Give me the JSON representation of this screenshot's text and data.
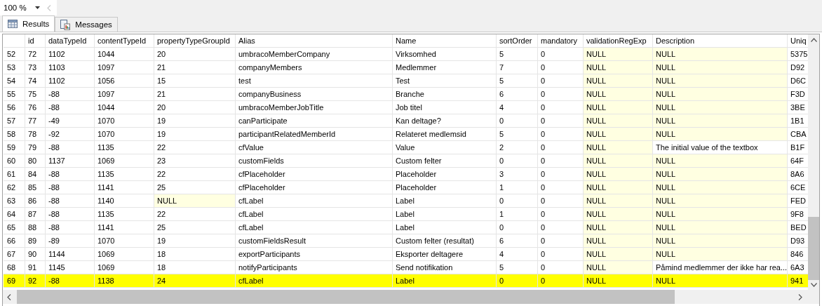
{
  "zoom": "100 %",
  "tabs": [
    {
      "label": "Results",
      "selected": true,
      "kind": "grid"
    },
    {
      "label": "Messages",
      "selected": false,
      "kind": "messages"
    }
  ],
  "columns": [
    "id",
    "dataTypeId",
    "contentTypeId",
    "propertyTypeGroupId",
    "Alias",
    "Name",
    "sortOrder",
    "mandatory",
    "validationRegExp",
    "Description",
    "Uniq"
  ],
  "rows": [
    {
      "row_number": "52",
      "selected": false,
      "cells": [
        "72",
        "1102",
        "1044",
        "20",
        "umbracoMemberCompany",
        "Virksomhed",
        "5",
        "0",
        {
          "text": "NULL",
          "null": true
        },
        {
          "text": "NULL",
          "null": true
        },
        "5375"
      ]
    },
    {
      "row_number": "53",
      "selected": false,
      "cells": [
        "73",
        "1103",
        "1097",
        "21",
        "companyMembers",
        "Medlemmer",
        "7",
        "0",
        {
          "text": "NULL",
          "null": true
        },
        {
          "text": "NULL",
          "null": true
        },
        "D92"
      ]
    },
    {
      "row_number": "54",
      "selected": false,
      "cells": [
        "74",
        "1102",
        "1056",
        "15",
        "test",
        "Test",
        "5",
        "0",
        {
          "text": "NULL",
          "null": true
        },
        {
          "text": "NULL",
          "null": true
        },
        "D6C"
      ]
    },
    {
      "row_number": "55",
      "selected": false,
      "cells": [
        "75",
        "-88",
        "1097",
        "21",
        "companyBusiness",
        "Branche",
        "6",
        "0",
        {
          "text": "NULL",
          "null": true
        },
        {
          "text": "NULL",
          "null": true
        },
        "F3D"
      ]
    },
    {
      "row_number": "56",
      "selected": false,
      "cells": [
        "76",
        "-88",
        "1044",
        "20",
        "umbracoMemberJobTitle",
        "Job titel",
        "4",
        "0",
        {
          "text": "NULL",
          "null": true
        },
        {
          "text": "NULL",
          "null": true
        },
        "3BE"
      ]
    },
    {
      "row_number": "57",
      "selected": false,
      "cells": [
        "77",
        "-49",
        "1070",
        "19",
        "canParticipate",
        "Kan deltage?",
        "0",
        "0",
        {
          "text": "NULL",
          "null": true
        },
        {
          "text": "NULL",
          "null": true
        },
        "1B1"
      ]
    },
    {
      "row_number": "58",
      "selected": false,
      "cells": [
        "78",
        "-92",
        "1070",
        "19",
        "participantRelatedMemberId",
        "Relateret medlemsid",
        "5",
        "0",
        {
          "text": "NULL",
          "null": true
        },
        {
          "text": "NULL",
          "null": true
        },
        "CBA"
      ]
    },
    {
      "row_number": "59",
      "selected": false,
      "cells": [
        "79",
        "-88",
        "1135",
        "22",
        "cfValue",
        "Value",
        "2",
        "0",
        {
          "text": "NULL",
          "null": true
        },
        "The initial value of the textbox",
        "B1F"
      ]
    },
    {
      "row_number": "60",
      "selected": false,
      "cells": [
        "80",
        "1137",
        "1069",
        "23",
        "customFields",
        "Custom felter",
        "0",
        "0",
        {
          "text": "NULL",
          "null": true
        },
        {
          "text": "NULL",
          "null": true
        },
        "64F"
      ]
    },
    {
      "row_number": "61",
      "selected": false,
      "cells": [
        "84",
        "-88",
        "1135",
        "22",
        "cfPlaceholder",
        "Placeholder",
        "3",
        "0",
        {
          "text": "NULL",
          "null": true
        },
        {
          "text": "NULL",
          "null": true
        },
        "8A6"
      ]
    },
    {
      "row_number": "62",
      "selected": false,
      "cells": [
        "85",
        "-88",
        "1141",
        "25",
        "cfPlaceholder",
        "Placeholder",
        "1",
        "0",
        {
          "text": "NULL",
          "null": true
        },
        {
          "text": "NULL",
          "null": true
        },
        "6CE"
      ]
    },
    {
      "row_number": "63",
      "selected": false,
      "cells": [
        "86",
        "-88",
        "1140",
        {
          "text": "NULL",
          "null": true
        },
        "cfLabel",
        "Label",
        "0",
        "0",
        {
          "text": "NULL",
          "null": true
        },
        {
          "text": "NULL",
          "null": true
        },
        "FED"
      ]
    },
    {
      "row_number": "64",
      "selected": false,
      "cells": [
        "87",
        "-88",
        "1135",
        "22",
        "cfLabel",
        "Label",
        "1",
        "0",
        {
          "text": "NULL",
          "null": true
        },
        {
          "text": "NULL",
          "null": true
        },
        "9F8"
      ]
    },
    {
      "row_number": "65",
      "selected": false,
      "cells": [
        "88",
        "-88",
        "1141",
        "25",
        "cfLabel",
        "Label",
        "0",
        "0",
        {
          "text": "NULL",
          "null": true
        },
        {
          "text": "NULL",
          "null": true
        },
        "BED"
      ]
    },
    {
      "row_number": "66",
      "selected": false,
      "cells": [
        "89",
        "-89",
        "1070",
        "19",
        "customFieldsResult",
        "Custom felter (resultat)",
        "6",
        "0",
        {
          "text": "NULL",
          "null": true
        },
        {
          "text": "NULL",
          "null": true
        },
        "D93"
      ]
    },
    {
      "row_number": "67",
      "selected": false,
      "cells": [
        "90",
        "1144",
        "1069",
        "18",
        "exportParticipants",
        "Eksporter deltagere",
        "4",
        "0",
        {
          "text": "NULL",
          "null": true
        },
        {
          "text": "NULL",
          "null": true
        },
        "846"
      ]
    },
    {
      "row_number": "68",
      "selected": false,
      "cells": [
        "91",
        "1145",
        "1069",
        "18",
        "notifyParticipants",
        "Send notifikation",
        "5",
        "0",
        {
          "text": "NULL",
          "null": true
        },
        "Påmind medlemmer der ikke har rea...",
        "6A3"
      ]
    },
    {
      "row_number": "69",
      "selected": true,
      "cells": [
        "92",
        "-88",
        "1138",
        "24",
        "cfLabel",
        "Label",
        "0",
        "0",
        "NULL",
        "NULL",
        "941"
      ]
    }
  ]
}
